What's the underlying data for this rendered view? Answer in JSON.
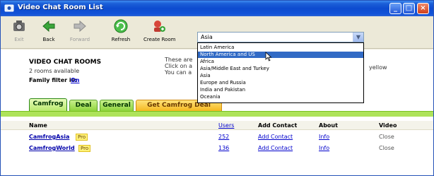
{
  "window": {
    "title": "Video Chat Room List"
  },
  "toolbar": {
    "items": [
      {
        "label": "Exit",
        "icon": "camera-icon",
        "disabled": true
      },
      {
        "label": "Back",
        "icon": "back-arrow-icon",
        "disabled": false
      },
      {
        "label": "Forward",
        "icon": "forward-arrow-icon",
        "disabled": true
      },
      {
        "label": "Refresh",
        "icon": "refresh-icon",
        "disabled": false
      },
      {
        "label": "Create Room",
        "icon": "create-room-icon",
        "disabled": false
      }
    ]
  },
  "room_select": {
    "value": "Asia",
    "options": [
      "Latin America",
      "North America and US",
      "Africa",
      "Asia/Middle East and Turkey",
      "Asia",
      "Europe and Russia",
      "India and Pakistan",
      "Oceania"
    ],
    "selected_index": 1
  },
  "panel": {
    "heading": "VIDEO CHAT ROOMS",
    "availability": "2 rooms available",
    "filter_label": "Family filter is:",
    "filter_value": "On",
    "instruction_lines": [
      "These are",
      "Click on a",
      "You can a"
    ],
    "instruction_tail": "yellow"
  },
  "tabs": [
    {
      "label": "Camfrog",
      "active": true
    },
    {
      "label": "Deal",
      "active": false
    },
    {
      "label": "General",
      "active": false
    },
    {
      "label": "Get Camfrog Deal",
      "active": false,
      "promo": true
    }
  ],
  "table": {
    "headers": {
      "name": "Name",
      "users": "Users",
      "add_contact": "Add Contact",
      "about": "About",
      "video": "Video"
    },
    "rows": [
      {
        "name": "CamfrogAsia",
        "tag": "Pro",
        "users": "252",
        "add_contact": "Add Contact",
        "about": "Info",
        "video": "Close"
      },
      {
        "name": "CamfrogWorld",
        "tag": "Pro",
        "users": "136",
        "add_contact": "Add Contact",
        "about": "Info",
        "video": "Close"
      }
    ]
  },
  "colors": {
    "title_bar": "#0d4bcf",
    "tab_green": "#8ed43c",
    "tab_promo": "#f5b820",
    "link_blue": "#0000cc",
    "selection": "#316ac5"
  }
}
